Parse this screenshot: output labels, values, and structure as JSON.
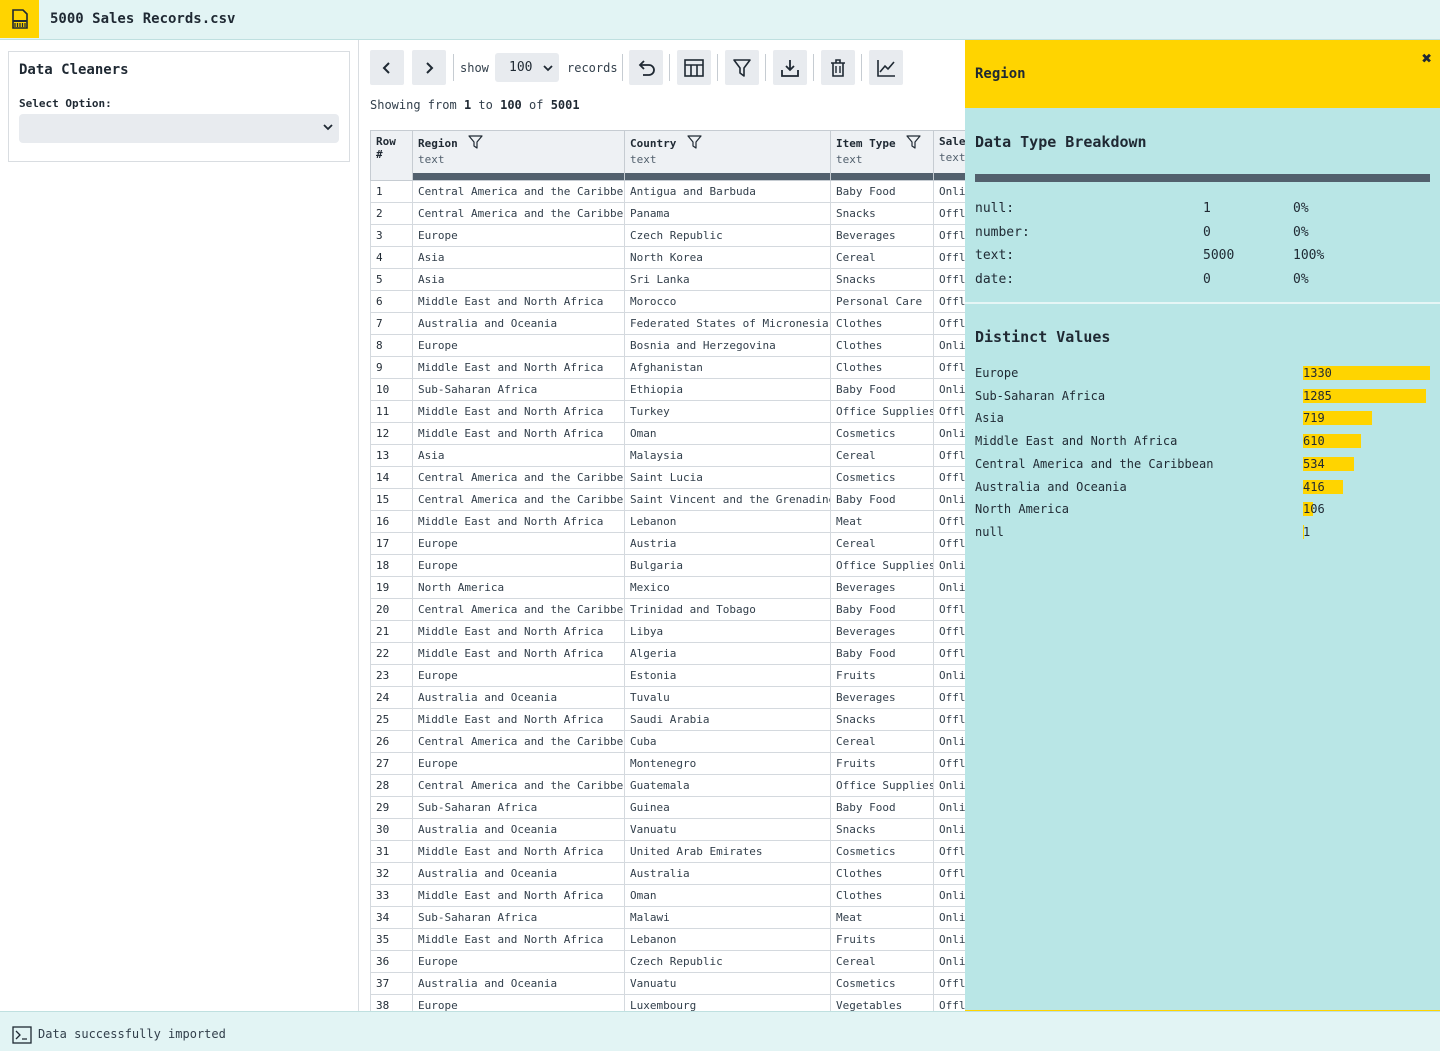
{
  "app": {
    "file_title": "5000 Sales Records.csv",
    "icon": "file-csv-icon"
  },
  "sidebar": {
    "title": "Data Cleaners",
    "select_label": "Select Option:",
    "select_value": ""
  },
  "toolbar": {
    "show_label": "show",
    "records_value": "100",
    "records_label": "records",
    "buttons": [
      "prev-page-icon",
      "next-page-icon",
      "undo-icon",
      "table-icon",
      "filter-icon",
      "download-icon",
      "trash-icon",
      "chart-line-icon"
    ]
  },
  "paging": {
    "prefix": "Showing from",
    "from": "1",
    "to_word": "to",
    "to": "100",
    "of_word": "of",
    "total": "5001"
  },
  "table": {
    "columns": [
      {
        "name": "Row #",
        "type": ""
      },
      {
        "name": "Region",
        "type": "text"
      },
      {
        "name": "Country",
        "type": "text"
      },
      {
        "name": "Item Type",
        "type": "text"
      },
      {
        "name": "Sales Channel",
        "type": "text"
      }
    ],
    "rows": [
      [
        "1",
        "Central America and the Caribbean",
        "Antigua and Barbuda",
        "Baby Food",
        "Online"
      ],
      [
        "2",
        "Central America and the Caribbean",
        "Panama",
        "Snacks",
        "Offline"
      ],
      [
        "3",
        "Europe",
        "Czech Republic",
        "Beverages",
        "Offline"
      ],
      [
        "4",
        "Asia",
        "North Korea",
        "Cereal",
        "Offline"
      ],
      [
        "5",
        "Asia",
        "Sri Lanka",
        "Snacks",
        "Offline"
      ],
      [
        "6",
        "Middle East and North Africa",
        "Morocco",
        "Personal Care",
        "Offline"
      ],
      [
        "7",
        "Australia and Oceania",
        "Federated States of Micronesia",
        "Clothes",
        "Offline"
      ],
      [
        "8",
        "Europe",
        "Bosnia and Herzegovina",
        "Clothes",
        "Online"
      ],
      [
        "9",
        "Middle East and North Africa",
        "Afghanistan",
        "Clothes",
        "Offline"
      ],
      [
        "10",
        "Sub-Saharan Africa",
        "Ethiopia",
        "Baby Food",
        "Online"
      ],
      [
        "11",
        "Middle East and North Africa",
        "Turkey",
        "Office Supplies",
        "Offline"
      ],
      [
        "12",
        "Middle East and North Africa",
        "Oman",
        "Cosmetics",
        "Online"
      ],
      [
        "13",
        "Asia",
        "Malaysia",
        "Cereal",
        "Offline"
      ],
      [
        "14",
        "Central America and the Caribbean",
        "Saint Lucia",
        "Cosmetics",
        "Offline"
      ],
      [
        "15",
        "Central America and the Caribbean",
        "Saint Vincent and the Grenadines",
        "Baby Food",
        "Online"
      ],
      [
        "16",
        "Middle East and North Africa",
        "Lebanon",
        "Meat",
        "Offline"
      ],
      [
        "17",
        "Europe",
        "Austria",
        "Cereal",
        "Offline"
      ],
      [
        "18",
        "Europe",
        "Bulgaria",
        "Office Supplies",
        "Online"
      ],
      [
        "19",
        "North America",
        "Mexico",
        "Beverages",
        "Online"
      ],
      [
        "20",
        "Central America and the Caribbean",
        "Trinidad and Tobago",
        "Baby Food",
        "Offline"
      ],
      [
        "21",
        "Middle East and North Africa",
        "Libya",
        "Beverages",
        "Offline"
      ],
      [
        "22",
        "Middle East and North Africa",
        "Algeria",
        "Baby Food",
        "Offline"
      ],
      [
        "23",
        "Europe",
        "Estonia",
        "Fruits",
        "Online"
      ],
      [
        "24",
        "Australia and Oceania",
        "Tuvalu",
        "Beverages",
        "Offline"
      ],
      [
        "25",
        "Middle East and North Africa",
        "Saudi Arabia",
        "Snacks",
        "Offline"
      ],
      [
        "26",
        "Central America and the Caribbean",
        "Cuba",
        "Cereal",
        "Online"
      ],
      [
        "27",
        "Europe",
        "Montenegro",
        "Fruits",
        "Offline"
      ],
      [
        "28",
        "Central America and the Caribbean",
        "Guatemala",
        "Office Supplies",
        "Online"
      ],
      [
        "29",
        "Sub-Saharan Africa",
        "Guinea",
        "Baby Food",
        "Online"
      ],
      [
        "30",
        "Australia and Oceania",
        "Vanuatu",
        "Snacks",
        "Online"
      ],
      [
        "31",
        "Middle East and North Africa",
        "United Arab Emirates",
        "Cosmetics",
        "Offline"
      ],
      [
        "32",
        "Australia and Oceania",
        "Australia",
        "Clothes",
        "Offline"
      ],
      [
        "33",
        "Middle East and North Africa",
        "Oman",
        "Clothes",
        "Online"
      ],
      [
        "34",
        "Sub-Saharan Africa",
        "Malawi",
        "Meat",
        "Online"
      ],
      [
        "35",
        "Middle East and North Africa",
        "Lebanon",
        "Fruits",
        "Online"
      ],
      [
        "36",
        "Europe",
        "Czech Republic",
        "Cereal",
        "Online"
      ],
      [
        "37",
        "Australia and Oceania",
        "Vanuatu",
        "Cosmetics",
        "Offline"
      ],
      [
        "38",
        "Europe",
        "Luxembourg",
        "Vegetables",
        "Offline"
      ]
    ]
  },
  "panel": {
    "title": "Region",
    "close_glyph": "✖",
    "dt_title": "Data Type Breakdown",
    "datatypes": [
      {
        "label": "null:",
        "count": "1",
        "pct": "0%"
      },
      {
        "label": "number:",
        "count": "0",
        "pct": "0%"
      },
      {
        "label": "text:",
        "count": "5000",
        "pct": "100%"
      },
      {
        "label": "date:",
        "count": "0",
        "pct": "0%"
      }
    ],
    "dv_title": "Distinct Values",
    "distinct": [
      {
        "label": "Europe",
        "count": "1330",
        "fraction": 1.0
      },
      {
        "label": "Sub-Saharan Africa",
        "count": "1285",
        "fraction": 0.966
      },
      {
        "label": "Asia",
        "count": "719",
        "fraction": 0.541
      },
      {
        "label": "Middle East and North Africa",
        "count": "610",
        "fraction": 0.459
      },
      {
        "label": "Central America and the Caribbean",
        "count": "534",
        "fraction": 0.402
      },
      {
        "label": "Australia and Oceania",
        "count": "416",
        "fraction": 0.313
      },
      {
        "label": "North America",
        "count": "106",
        "fraction": 0.08
      },
      {
        "label": "null",
        "count": "1",
        "fraction": 0.001
      }
    ],
    "accent_color": "#ffd400",
    "bg_color": "#b9e6e6"
  },
  "status": {
    "icon": "terminal-icon",
    "text": "Data successfully imported"
  }
}
